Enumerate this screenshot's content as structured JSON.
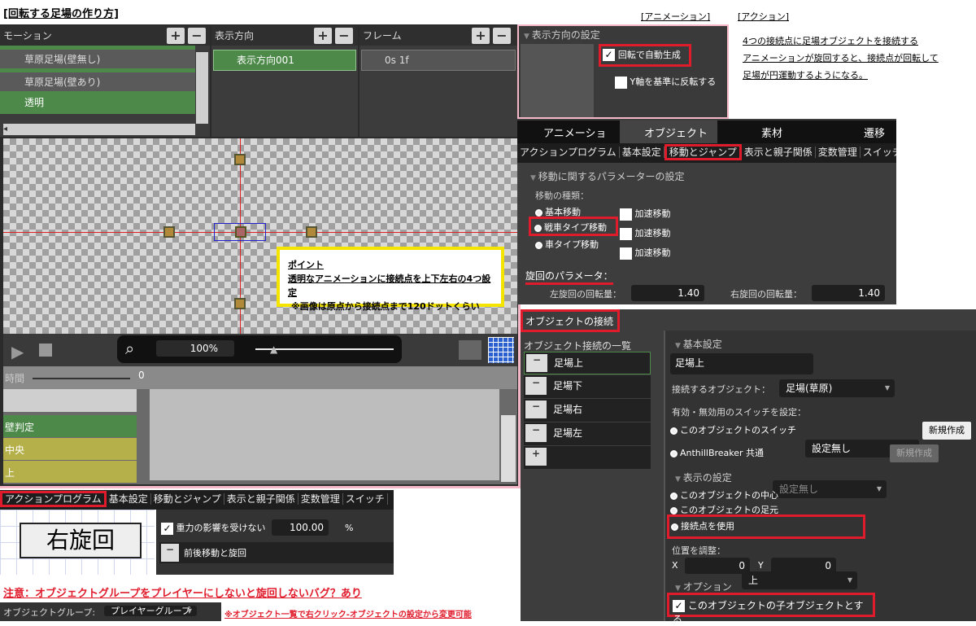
{
  "title": "[回転する足場の作り方]",
  "anim_link": "[アニメーション]",
  "action_link": "[アクション]",
  "action_desc": [
    "4つの接続点に足場オブジェクトを接続する",
    "アニメーションが旋回すると、接続点が回転して",
    "足場が円運動するようになる。"
  ],
  "motion": {
    "header": "モーション",
    "items": [
      "草原足場(壁無し)",
      "草原足場(壁あり)",
      "透明"
    ]
  },
  "direction": {
    "header": "表示方向",
    "item": "表示方向001"
  },
  "frame": {
    "header": "フレーム",
    "item": "0s 1f"
  },
  "dir_settings": {
    "header": "表示方向の設定",
    "auto": "回転で自動生成",
    "flip": "Y軸を基準に反転する"
  },
  "point": {
    "title": "ポイント",
    "line1": "透明なアニメーションに接続点を上下左右の4つ設定",
    "line2": "※画像は原点から接続点まで120ドットくらい"
  },
  "zoom": "100%",
  "timeline": {
    "time_label": "時間",
    "zero": "0",
    "rows": [
      "壁判定",
      "中央",
      "上"
    ]
  },
  "main_tabs": [
    "アニメーション",
    "オブジェクト",
    "素材",
    "遷移"
  ],
  "sub_tabs": [
    "アクションプログラム",
    "基本設定",
    "移動とジャンプ",
    "表示と親子関係",
    "変数管理",
    "スイッチ"
  ],
  "move": {
    "header": "移動に関するパラメーターの設定",
    "kind": "移動の種類：",
    "opts": [
      "基本移動",
      "戦車タイプ移動",
      "車タイプ移動"
    ],
    "accel": [
      "加速移動",
      "加速移動",
      "加速移動"
    ],
    "rot_header": "旋回のパラメータ：",
    "left_label": "左旋回の回転量：",
    "left_val": "1.40",
    "right_label": "右旋回の回転量：",
    "right_val": "1.40"
  },
  "conn": {
    "tab": "オブジェクトの接続",
    "list_header": "オブジェクト接続の一覧",
    "items": [
      "足場上",
      "足場下",
      "足場右",
      "足場左"
    ],
    "basic": "基本設定",
    "name": "足場上",
    "target_label": "接続するオブジェクト：",
    "target_val": "足場(草原)",
    "switch_label": "有効・無効用のスイッチを設定：",
    "sw1": "このオブジェクトのスイッチ",
    "sw1_val": "設定無し",
    "new1": "新規作成",
    "sw2": "AnthillBreaker 共通",
    "sw2_val": "設定無し",
    "new2": "新規作成",
    "disp": "表示の設定",
    "d1": "このオブジェクトの中心",
    "d2": "このオブジェクトの足元",
    "d3": "接続点を使用",
    "d3_val": "上",
    "pos": "位置を調整：",
    "x_label": "X",
    "x_val": "0",
    "y_label": "Y",
    "y_val": "0",
    "opt": "オプション",
    "child": "このオブジェクトの子オブジェクトとする"
  },
  "bottom": {
    "tabs": [
      "アクションプログラム",
      "基本設定",
      "移動とジャンプ",
      "表示と親子関係",
      "変数管理",
      "スイッチ"
    ],
    "node": "右旋回",
    "gravity": "重力の影響を受けない",
    "gravity_val": "100.00",
    "pct": "%",
    "action": "前後移動と旋回"
  },
  "warn": "注意：オブジェクトグループをプレイヤーにしないと旋回しないバグ？あり",
  "group_label": "オブジェクトグループ:",
  "group_val": "プレイヤーグループ",
  "group_note": "※オブジェクト一覧で右クリック-オブジェクトの設定から変更可能",
  "colors": {
    "red": "#e01c2c",
    "green": "#4d8a4a",
    "yellow": "#f5e400"
  }
}
